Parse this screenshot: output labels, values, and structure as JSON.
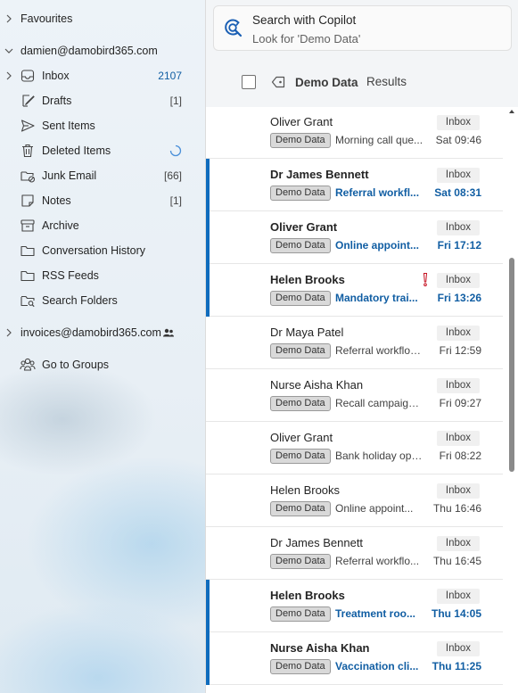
{
  "sidebar": {
    "favourites": "Favourites",
    "account1": "damien@damobird365.com",
    "folders": [
      {
        "label": "Inbox",
        "count": "2107",
        "icon": "inbox-icon"
      },
      {
        "label": "Drafts",
        "count": "[1]",
        "icon": "drafts-icon"
      },
      {
        "label": "Sent Items",
        "count": "",
        "icon": "sent-icon"
      },
      {
        "label": "Deleted Items",
        "count": "",
        "icon": "trash-icon"
      },
      {
        "label": "Junk Email",
        "count": "[66]",
        "icon": "junk-icon"
      },
      {
        "label": "Notes",
        "count": "[1]",
        "icon": "notes-icon"
      },
      {
        "label": "Archive",
        "count": "",
        "icon": "archive-icon"
      },
      {
        "label": "Conversation History",
        "count": "",
        "icon": "folder-icon"
      },
      {
        "label": "RSS Feeds",
        "count": "",
        "icon": "folder-icon"
      },
      {
        "label": "Search Folders",
        "count": "",
        "icon": "search-folder-icon"
      }
    ],
    "account2": "invoices@damobird365.com",
    "groups": "Go to Groups"
  },
  "search": {
    "title": "Search with Copilot",
    "subtitle": "Look for 'Demo Data'"
  },
  "filter": {
    "name": "Demo Data",
    "results": "Results"
  },
  "messages": [
    {
      "sender": "Oliver Grant",
      "folder": "Inbox",
      "category": "Demo Data",
      "subject": "Morning call que...",
      "time": "Sat 09:46",
      "unread": false,
      "important": false
    },
    {
      "sender": "Dr James Bennett",
      "folder": "Inbox",
      "category": "Demo Data",
      "subject": "Referral workfl...",
      "time": "Sat 08:31",
      "unread": true,
      "important": false
    },
    {
      "sender": "Oliver Grant",
      "folder": "Inbox",
      "category": "Demo Data",
      "subject": "Online appoint...",
      "time": "Fri 17:12",
      "unread": true,
      "important": false
    },
    {
      "sender": "Helen Brooks",
      "folder": "Inbox",
      "category": "Demo Data",
      "subject": "Mandatory trai...",
      "time": "Fri 13:26",
      "unread": true,
      "important": true
    },
    {
      "sender": "Dr Maya Patel",
      "folder": "Inbox",
      "category": "Demo Data",
      "subject": "Referral workflow...",
      "time": "Fri 12:59",
      "unread": false,
      "important": false
    },
    {
      "sender": "Nurse Aisha Khan",
      "folder": "Inbox",
      "category": "Demo Data",
      "subject": "Recall campaign s...",
      "time": "Fri 09:27",
      "unread": false,
      "important": false
    },
    {
      "sender": "Oliver Grant",
      "folder": "Inbox",
      "category": "Demo Data",
      "subject": "Bank holiday ope...",
      "time": "Fri 08:22",
      "unread": false,
      "important": false
    },
    {
      "sender": "Helen Brooks",
      "folder": "Inbox",
      "category": "Demo Data",
      "subject": "Online appoint...",
      "time": "Thu 16:46",
      "unread": false,
      "important": false
    },
    {
      "sender": "Dr James Bennett",
      "folder": "Inbox",
      "category": "Demo Data",
      "subject": "Referral workflo...",
      "time": "Thu 16:45",
      "unread": false,
      "important": false
    },
    {
      "sender": "Helen Brooks",
      "folder": "Inbox",
      "category": "Demo Data",
      "subject": "Treatment roo...",
      "time": "Thu 14:05",
      "unread": true,
      "important": false
    },
    {
      "sender": "Nurse Aisha Khan",
      "folder": "Inbox",
      "category": "Demo Data",
      "subject": "Vaccination cli...",
      "time": "Thu 11:25",
      "unread": true,
      "important": false
    }
  ],
  "colors": {
    "accent": "#0f6cbd",
    "unread_text": "#115ea3",
    "important": "#c50f1f"
  }
}
